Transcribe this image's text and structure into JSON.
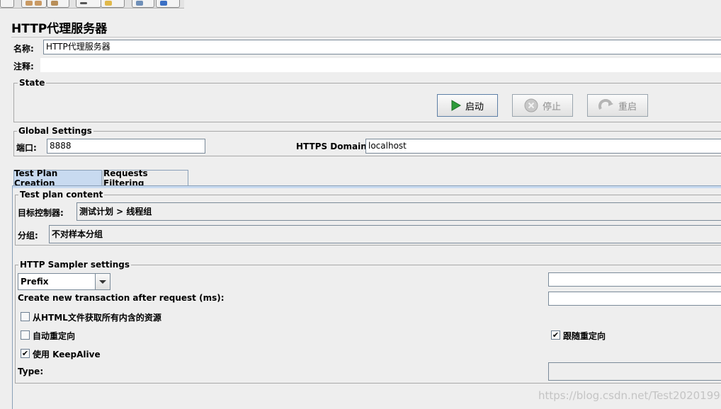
{
  "title": "HTTP代理服务器",
  "name_label": "名称:",
  "name_value": "HTTP代理服务器",
  "comment_label": "注释:",
  "comment_value": "",
  "state": {
    "legend": "State",
    "start_label": "启动",
    "stop_label": "停止",
    "restart_label": "重启"
  },
  "global": {
    "legend": "Global Settings",
    "port_label": "端口:",
    "port_value": "8888",
    "https_label": "HTTPS Domains:",
    "https_value": "localhost"
  },
  "tabs": [
    {
      "label": "Test Plan Creation"
    },
    {
      "label": "Requests Filtering"
    }
  ],
  "test_plan": {
    "legend": "Test plan content",
    "target_label": "目标控制器:",
    "target_value": "测试计划 > 线程组",
    "grouping_label": "分组:",
    "grouping_value": "不对样本分组"
  },
  "sampler": {
    "legend": "HTTP Sampler settings",
    "prefix_value": "Prefix",
    "prefix_input": "",
    "transaction_label": "Create new transaction after request (ms):",
    "transaction_value": "",
    "retrieve_resources_label": "从HTML文件获取所有内含的资源",
    "auto_redirect_label": "自动重定向",
    "follow_redirect_label": "跟随重定向",
    "keepalive_label": "使用 KeepAlive",
    "type_label": "Type:",
    "type_value": ""
  },
  "watermark": "https://blog.csdn.net/Test20201990"
}
